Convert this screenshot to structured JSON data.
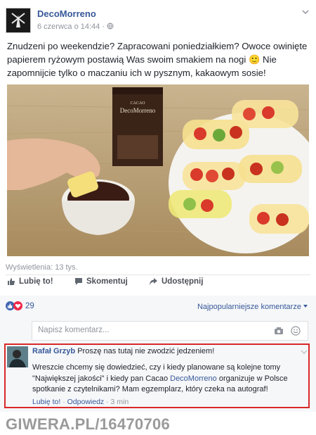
{
  "post": {
    "page_name": "DecoMorreno",
    "date": "6 czerwca o 14:44",
    "text": "Znudzeni po weekendzie? Zapracowani poniedziałkiem? Owoce owinięte papierem ryżowym postawią Was swoim smakiem na nogi 🙂 Nie zapomnijcie tylko o maczaniu ich w pysznym, kakaowym sosie!",
    "views": "Wyświetlenia: 13 tys."
  },
  "media": {
    "box_brand_top": "CACAO",
    "box_brand": "DecoMorreno"
  },
  "actions": {
    "like": "Lubię to!",
    "comment": "Skomentuj",
    "share": "Udostępnij"
  },
  "reactions": {
    "count": "29",
    "sort": "Najpopularniejsze komentarze"
  },
  "comment_box": {
    "placeholder": "Napisz komentarz..."
  },
  "comment": {
    "author": "Rafał Grzyb",
    "first_line": "Proszę nas tutaj nie zwodzić jedzeniem!",
    "body_a": "Wreszcie chcemy się dowiedzieć, czy i kiedy planowane są kolejne tomy \"Największej jakości\" i kiedy pan Cacao ",
    "body_link": "DecoMorreno",
    "body_b": " organizuje w Polsce spotkanie z czytelnikami? Mam egzemplarz, który czeka na autograf!",
    "like": "Lubię to!",
    "reply": "Odpowiedz",
    "time": "3 min",
    "sep": " · "
  },
  "watermark": "GIWERA.PL/16470706",
  "colors": {
    "link": "#365899",
    "highlight": "#d82828"
  }
}
